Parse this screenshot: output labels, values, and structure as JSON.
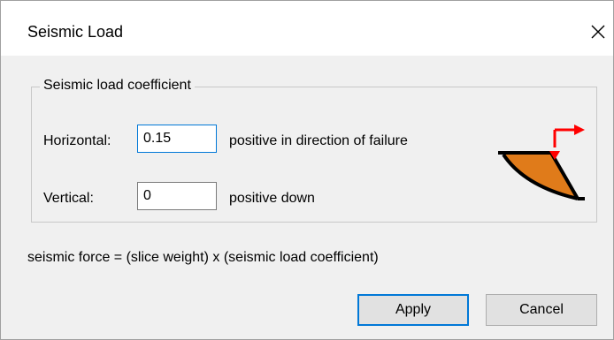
{
  "window": {
    "title": "Seismic Load",
    "close_icon": "close-icon"
  },
  "group": {
    "legend": "Seismic load coefficient",
    "horizontal": {
      "label": "Horizontal:",
      "value": "0.15",
      "hint": "positive in direction of failure"
    },
    "vertical": {
      "label": "Vertical:",
      "value": "0",
      "hint": "positive down"
    }
  },
  "illustration": {
    "icon": "slope-failure-icon",
    "slope_color": "#e07b1a",
    "arrow_color": "#ff0000"
  },
  "formula": "seismic force = (slice weight) x (seismic load coefficient)",
  "buttons": {
    "apply": "Apply",
    "cancel": "Cancel"
  },
  "colors": {
    "accent": "#0078d7"
  }
}
